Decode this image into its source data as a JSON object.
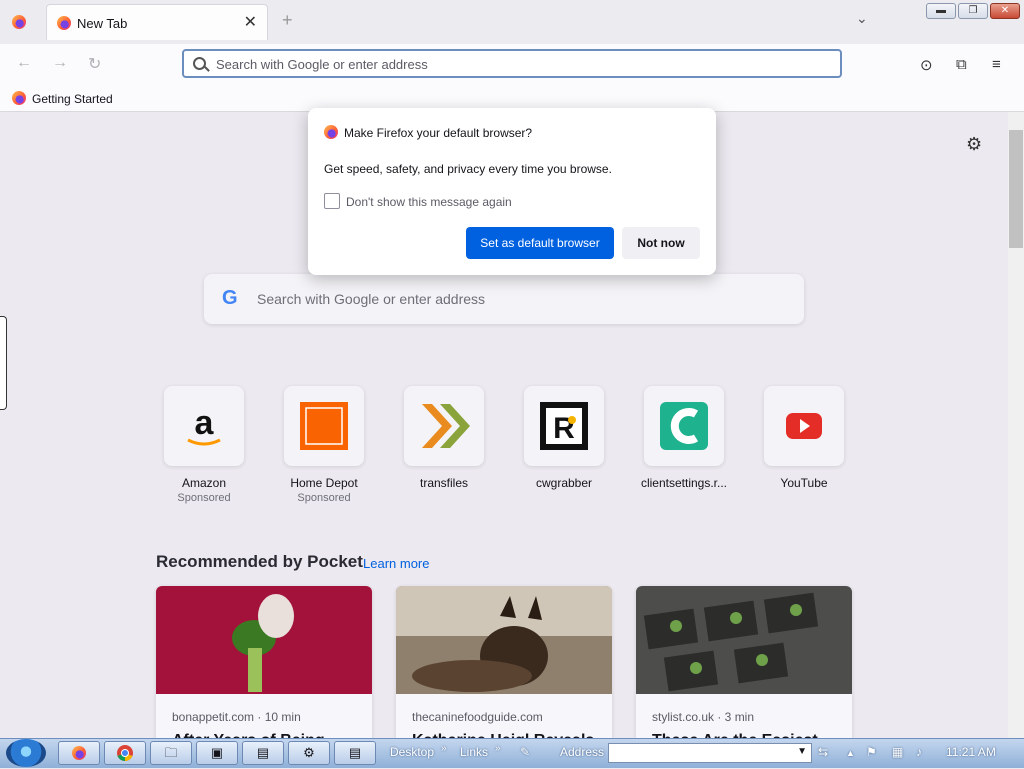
{
  "browser": {
    "tab_title": "New Tab",
    "tab_close": "✕",
    "new_tab": "+",
    "list_all_tabs": "⌄",
    "window_buttons": {
      "minimize": "▬",
      "restore": "❐",
      "close": "✕"
    },
    "nav": {
      "back": "←",
      "forward": "→",
      "reload": "↻"
    },
    "urlbar_placeholder": "Search with Google or enter address",
    "toolbar_icons": {
      "pocket": "⊙",
      "extensions": "⧉",
      "menu": "≡"
    },
    "bookmarks": [
      {
        "label": "Getting Started"
      }
    ]
  },
  "newtab": {
    "settings_icon": "⚙",
    "search": {
      "logo": "G",
      "placeholder": "Search with Google or enter address"
    },
    "top_sites": [
      {
        "label": "Amazon",
        "sponsored": "Sponsored",
        "icon": "amazon-icon"
      },
      {
        "label": "Home Depot",
        "sponsored": "Sponsored",
        "icon": "home-depot-icon"
      },
      {
        "label": "transfiles",
        "sponsored": "",
        "icon": "transfiles-icon"
      },
      {
        "label": "cwgrabber",
        "sponsored": "",
        "icon": "cwgrabber-icon"
      },
      {
        "label": "clientsettings.r...",
        "sponsored": "",
        "icon": "clientsettings-icon"
      },
      {
        "label": "YouTube",
        "sponsored": "",
        "icon": "youtube-icon"
      }
    ],
    "pocket": {
      "heading": "Recommended by Pocket",
      "learn_more": "Learn more",
      "cards": [
        {
          "source": "bonappetit.com · 10 min",
          "title": "After Years of Being..."
        },
        {
          "source": "thecaninefoodguide.com",
          "title": "Katherine Heigl Reveals..."
        },
        {
          "source": "stylist.co.uk · 3 min",
          "title": "These Are the Easiest..."
        }
      ]
    }
  },
  "dialog": {
    "title": "Make Firefox your default browser?",
    "body": "Get speed, safety, and privacy every time you browse.",
    "checkbox_label": "Don't show this message again",
    "checkbox_checked": false,
    "primary_button": "Set as default browser",
    "secondary_button": "Not now"
  },
  "taskbar": {
    "desktop": "Desktop",
    "links": "Links",
    "address_label": "Address",
    "clock": "11:21 AM"
  },
  "colors": {
    "accent": "#0061e0",
    "urlbar_border": "#6c8ebf",
    "taskbar": "#8fb0d8"
  }
}
